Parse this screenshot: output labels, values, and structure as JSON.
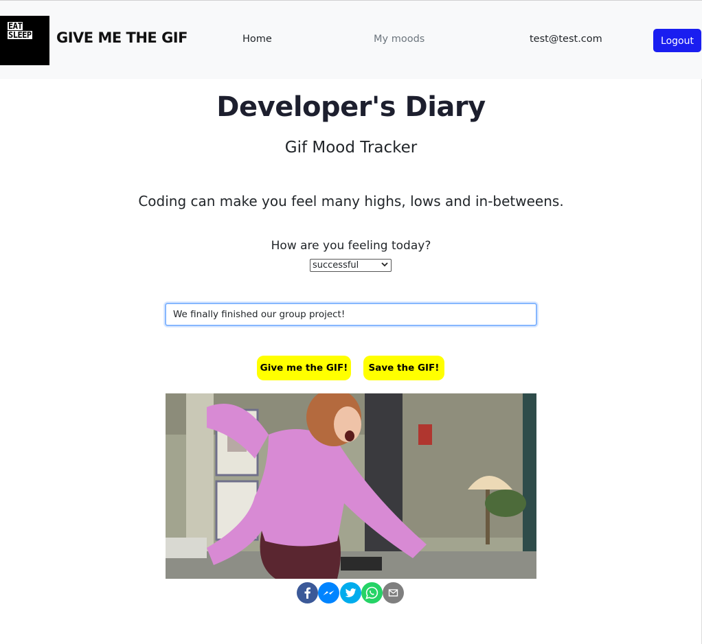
{
  "header": {
    "logo_line1": "EAT",
    "logo_line2": "SLEEP",
    "brand": "GIVE ME THE GIF",
    "nav_home": "Home",
    "nav_moods": "My moods",
    "user_email": "test@test.com",
    "logout_label": "Logout"
  },
  "main": {
    "title": "Developer's Diary",
    "subtitle": "Gif Mood Tracker",
    "tagline": "Coding can make you feel many highs, lows and in-betweens.",
    "question": "How are you feeling today?",
    "mood_selected": "successful",
    "entry_text": "We finally finished our group project!",
    "give_button": "Give me the GIF!",
    "save_button": "Save the GIF!"
  },
  "share": {
    "icons": [
      "facebook-icon",
      "messenger-icon",
      "twitter-icon",
      "whatsapp-icon",
      "email-icon"
    ]
  },
  "colors": {
    "navbar_bg": "#f8f9fa",
    "logout_bg": "#1a1ef0",
    "button_yellow": "#ffff00",
    "facebook": "#3b5998",
    "messenger": "#0084ff",
    "twitter": "#00aced",
    "whatsapp": "#25d366",
    "email": "#7f7f7f"
  }
}
